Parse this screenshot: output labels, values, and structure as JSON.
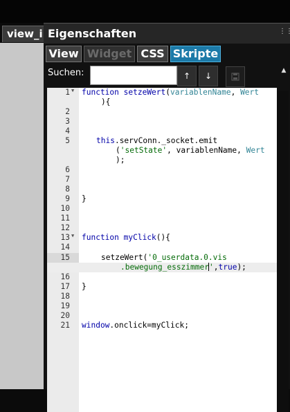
{
  "view_tab": "view_i",
  "panel": {
    "title": "Eigenschaften"
  },
  "tabs": {
    "view": "View",
    "widget": "Widget",
    "css": "CSS",
    "skripte": "Skripte"
  },
  "search": {
    "label": "Suchen:",
    "value": "",
    "up_icon": "arrow-up-icon",
    "down_icon": "arrow-down-icon",
    "save_icon": "save-icon"
  },
  "editor": {
    "line_numbers": [
      "1",
      "2",
      "3",
      "4",
      "5",
      "6",
      "7",
      "8",
      "9",
      "10",
      "11",
      "12",
      "13",
      "14",
      "15",
      "16",
      "17",
      "18",
      "19",
      "20",
      "21"
    ],
    "highlighted_line": "15",
    "lines": {
      "l1a": "function",
      "l1b": "setzeWert",
      "l1c": "(",
      "l1d": "variablenName",
      "l1e": ", ",
      "l1f": "Wert",
      "l1g": "){",
      "l5a": "this",
      "l5b": ".servConn._socket.emit",
      "l5c": "(",
      "l5d": "'setState'",
      "l5e": ", variablenName, ",
      "l5f": "Wert",
      "l5g": ");",
      "l9": "}",
      "l13a": "function",
      "l13b": "myClick",
      "l13c": "(){",
      "l15a": "setzeWert(",
      "l15b": "'0_userdata.0.vis",
      "l15c": ".bewegung_esszimmer",
      "l15d": "'",
      "l15e": ",",
      "l15f": "true",
      "l15g": ");",
      "l17": "}",
      "l21a": "window",
      "l21b": ".onclick=myClick;"
    }
  }
}
